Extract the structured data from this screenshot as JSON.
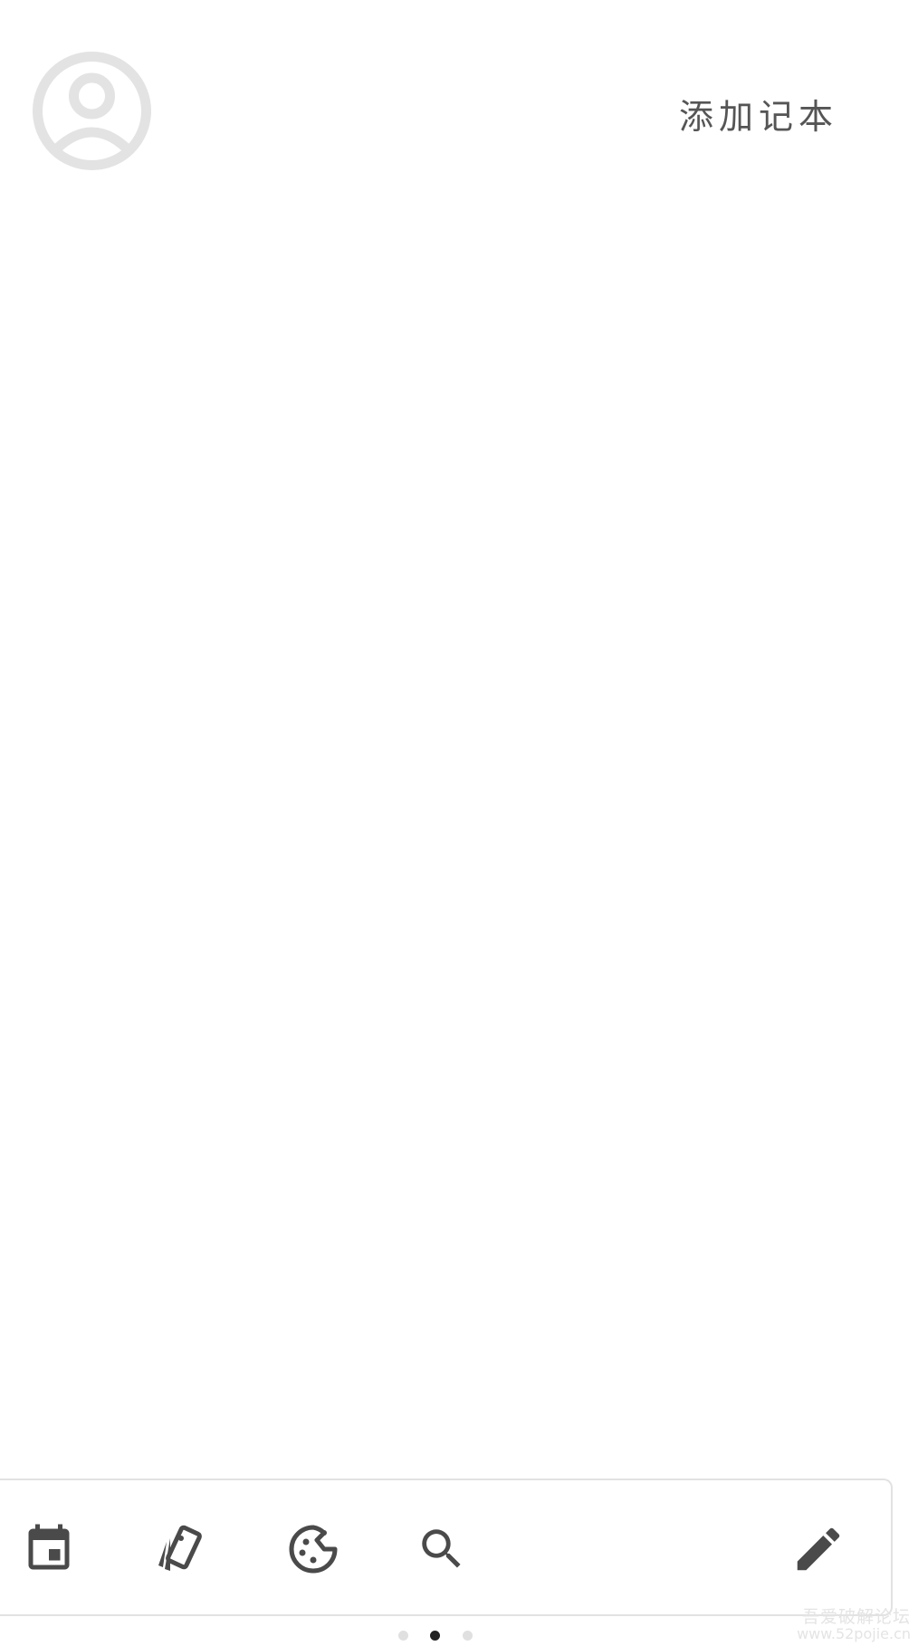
{
  "header": {
    "avatar_icon": "account-circle-icon",
    "add_notebook_label": "添加记本"
  },
  "toolbar": {
    "buttons": [
      {
        "name": "calendar-button",
        "icon": "calendar-icon"
      },
      {
        "name": "cards-button",
        "icon": "cards-icon"
      },
      {
        "name": "palette-button",
        "icon": "palette-icon"
      },
      {
        "name": "search-button",
        "icon": "search-icon"
      },
      {
        "name": "edit-button",
        "icon": "pencil-icon"
      }
    ]
  },
  "pager": {
    "count": 3,
    "active_index": 1
  },
  "watermark": {
    "line1": "吾爱破解论坛",
    "line2": "www.52pojie.cn"
  },
  "colors": {
    "icon": "#4a4a4a",
    "avatar": "#e3e3e3",
    "border": "#e2e2e2",
    "dot_active": "#222222",
    "dot_inactive": "#e0e0e0"
  }
}
